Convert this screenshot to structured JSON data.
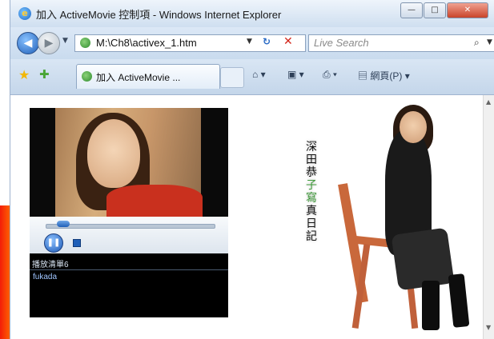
{
  "window": {
    "title": "加入 ActiveMovie 控制項 - Windows Internet Explorer",
    "min_label": "—",
    "max_label": "□",
    "close_label": "✕"
  },
  "address": {
    "url": "M:\\Ch8\\activex_1.htm",
    "search_placeholder": "Live Search"
  },
  "tabs": {
    "active_label": "加入 ActiveMovie ..."
  },
  "toolbar": {
    "page_label": "網頁(P)"
  },
  "player": {
    "playlist_title": "播放清單6",
    "items": [
      "fukada"
    ]
  },
  "page": {
    "vertical_title": [
      "深",
      "田",
      "恭",
      "子",
      "寫",
      "真",
      "日",
      "記"
    ]
  },
  "colors": {
    "accent_red": "#f31d08",
    "chrome": "#dbe7f5"
  },
  "icons": [
    "ie-logo-icon",
    "back-icon",
    "forward-icon",
    "refresh-icon",
    "stop-icon",
    "search-icon",
    "favorites-star-icon",
    "add-favorites-icon",
    "home-icon",
    "feeds-icon",
    "print-icon",
    "page-icon",
    "play-pause-icon",
    "stop-icon"
  ]
}
